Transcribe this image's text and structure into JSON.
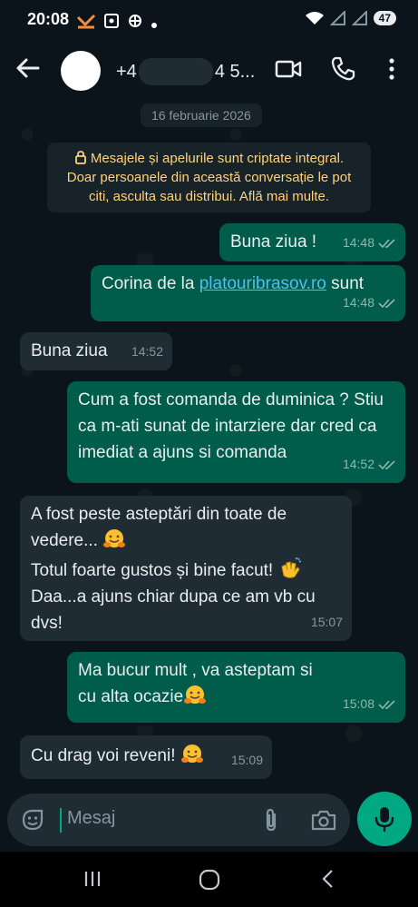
{
  "status_bar": {
    "time": "20:08",
    "battery": "47"
  },
  "header": {
    "contact_prefix": "+4",
    "contact_suffix": "4 5..."
  },
  "chat": {
    "date": "16 februarie 2026",
    "encryption_notice": "Mesajele și apelurile sunt criptate integral. Doar persoanele din această conversație le pot citi, asculta sau distribui. Află mai multe.",
    "messages": [
      {
        "direction": "out",
        "text": "Buna ziua !",
        "time": "14:48",
        "status": "read"
      },
      {
        "direction": "out",
        "text_before": "Corina de la ",
        "link": "platouribrasov.ro",
        "text_after": " sunt",
        "time": "14:48",
        "status": "read"
      },
      {
        "direction": "in",
        "text": "Buna ziua",
        "time": "14:52"
      },
      {
        "direction": "out",
        "text": "Cum a fost comanda de duminica ? Stiu ca m-ati sunat de intarziere dar cred ca imediat a ajuns si comanda",
        "time": "14:52",
        "status": "read"
      },
      {
        "direction": "in",
        "line1": "A fost peste asteptări din toate de vedere...",
        "line2": "Totul foarte gustos și bine facut!",
        "line3": "Daa...a ajuns chiar dupa ce am vb cu dvs!",
        "time": "15:07"
      },
      {
        "direction": "out",
        "text": "Ma bucur mult , va asteptam si cu alta ocazie",
        "time": "15:08",
        "status": "read"
      },
      {
        "direction": "in",
        "text": "Cu drag voi reveni!",
        "time": "15:09"
      }
    ]
  },
  "input": {
    "placeholder": "Mesaj"
  },
  "colors": {
    "background": "#0b141a",
    "outgoing_bubble": "#005c4b",
    "incoming_bubble": "#202c33",
    "accent": "#00a884",
    "link": "#53bdeb",
    "notice_text": "#ffd279"
  }
}
